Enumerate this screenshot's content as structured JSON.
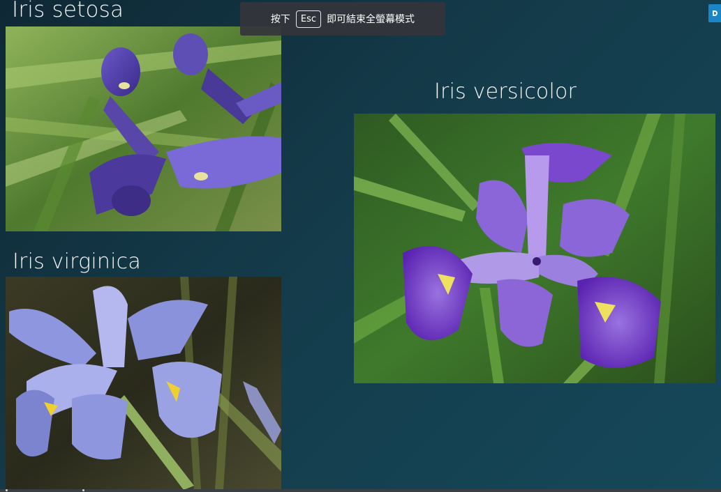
{
  "slide": {
    "captions": {
      "setosa": "Iris setosa",
      "virginica": "Iris virginica",
      "versicolor": "Iris versicolor"
    },
    "photos": [
      {
        "name": "Iris setosa",
        "icon": "iris-setosa-photo"
      },
      {
        "name": "Iris virginica",
        "icon": "iris-virginica-photo"
      },
      {
        "name": "Iris versicolor",
        "icon": "iris-versicolor-photo"
      }
    ],
    "background_colors": [
      "#0f2835",
      "#15485a"
    ]
  },
  "fullscreen_notice": {
    "prefix": "按下",
    "key": "Esc",
    "suffix": "即可結束全螢幕模式"
  },
  "colors": {
    "accent": "#1a86c8",
    "caption_text": "#f2f5f7",
    "banner_bg": "#34343a"
  }
}
